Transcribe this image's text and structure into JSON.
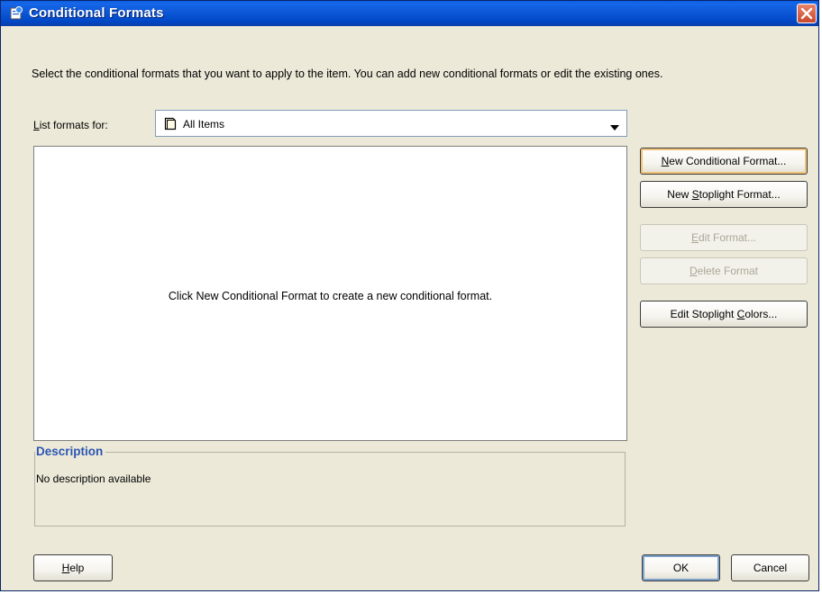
{
  "window": {
    "title": "Conditional Formats"
  },
  "instruction": "Select the conditional formats that you want to apply to the item. You can add new conditional formats or edit the existing ones.",
  "list_formats": {
    "label_mnemonic": "L",
    "label_rest": "ist formats for:",
    "selected": "All Items",
    "icon": "document-icon"
  },
  "formats_list": {
    "empty_message": "Click New Conditional Format to create a new conditional format."
  },
  "buttons": {
    "new_conditional": {
      "mnemonic": "N",
      "rest": "ew Conditional Format..."
    },
    "new_stoplight": {
      "pre": "New ",
      "mnemonic": "S",
      "rest": "toplight Format..."
    },
    "edit_format": {
      "mnemonic": "E",
      "rest": "dit Format..."
    },
    "delete_format": {
      "mnemonic": "D",
      "rest": "elete Format"
    },
    "edit_colors": {
      "pre": "Edit Stoplight ",
      "mnemonic": "C",
      "rest": "olors..."
    },
    "help": {
      "mnemonic": "H",
      "rest": "elp"
    },
    "ok": "OK",
    "cancel": "Cancel"
  },
  "description": {
    "legend": "Description",
    "text": "No description available"
  },
  "colors": {
    "accent": "#2d56b3",
    "titlebar": "#0a5fe0",
    "dialog_bg": "#ece9d8"
  }
}
